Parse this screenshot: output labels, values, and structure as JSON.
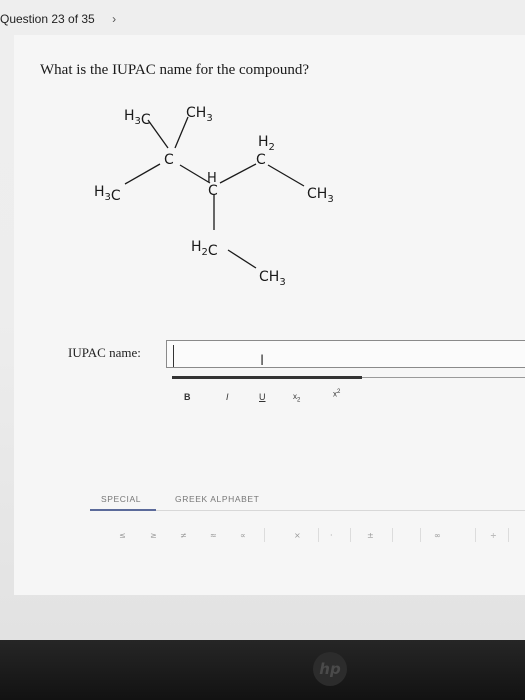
{
  "nav": {
    "question_counter": "Question 23 of 35",
    "next_icon": "chevron-right-icon"
  },
  "question": {
    "prompt": "What is the IUPAC name for the compound?"
  },
  "structure_labels": {
    "h3c_top": "H3C",
    "ch3_top": "CH3",
    "c_quat": "C",
    "h3c_left": "H3C",
    "h_ch": "H",
    "c_ch": "C",
    "h2_right": "H2",
    "c_ch2_right": "C",
    "ch3_right": "CH3",
    "h2c_bottom": "H2C",
    "ch3_bottom": "CH3"
  },
  "answer": {
    "label": "IUPAC name:",
    "value": "",
    "placeholder": ""
  },
  "formatting": {
    "bold": "B",
    "italic": "I",
    "underline": "U",
    "subscript": "X2",
    "superscript": "X2"
  },
  "tabs": [
    {
      "label": "SPECIAL",
      "active": true
    },
    {
      "label": "GREEK ALPHABET",
      "active": false
    }
  ],
  "special_symbols": [
    "≤",
    "≥",
    "≠",
    "≈",
    "∝",
    "×",
    "·",
    "±",
    "∞",
    "÷"
  ],
  "device": {
    "logo": "hp"
  },
  "colors": {
    "active_tab_underline": "#5b6a9a",
    "input_border": "#8a8a8a"
  }
}
